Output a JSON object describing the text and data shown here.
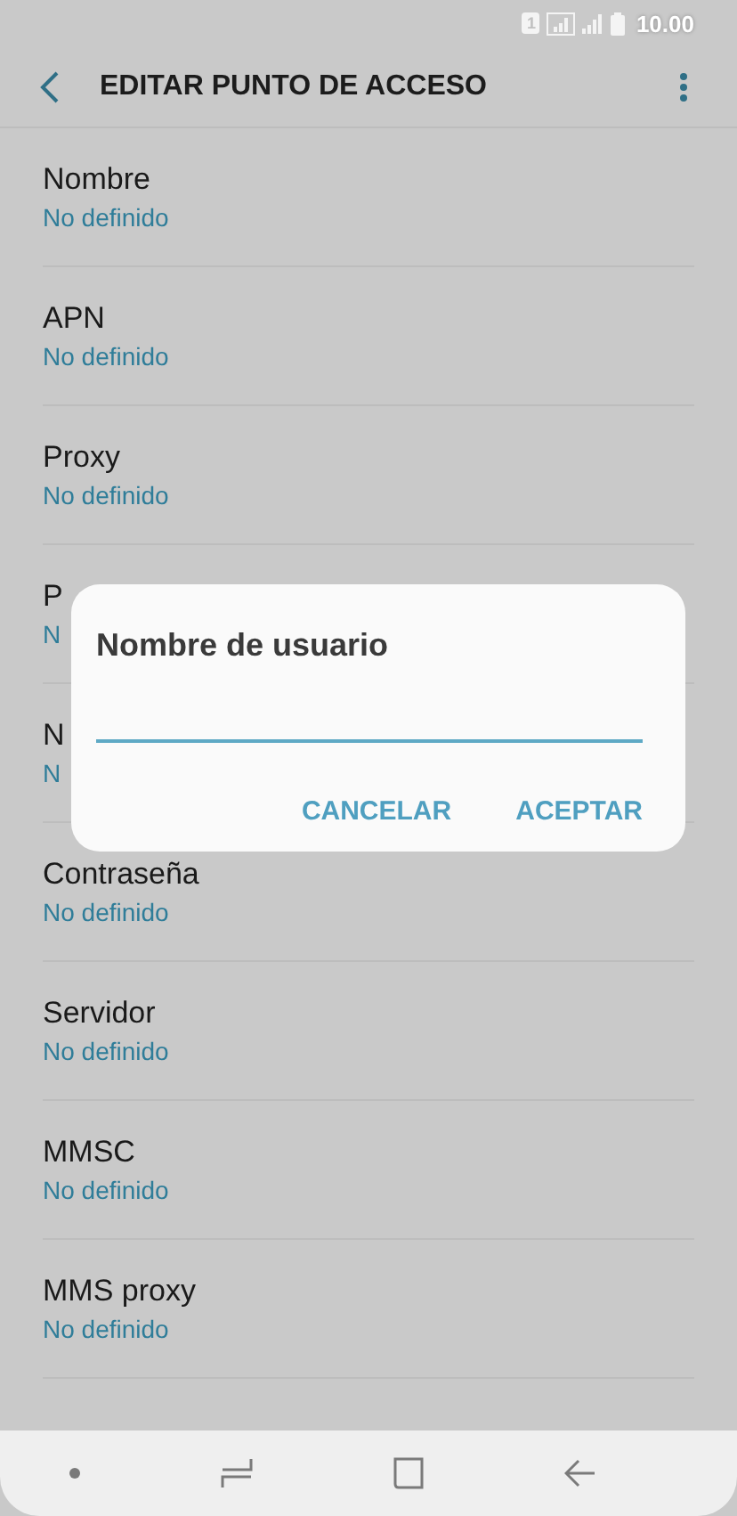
{
  "status_bar": {
    "sim": "1",
    "time": "10.00"
  },
  "app_bar": {
    "title": "EDITAR PUNTO DE ACCESO"
  },
  "settings": [
    {
      "title": "Nombre",
      "value": "No definido"
    },
    {
      "title": "APN",
      "value": "No definido"
    },
    {
      "title": "Proxy",
      "value": "No definido"
    },
    {
      "title": "P",
      "value": "N"
    },
    {
      "title": "N",
      "value": "N"
    },
    {
      "title": "Contraseña",
      "value": "No definido"
    },
    {
      "title": "Servidor",
      "value": "No definido"
    },
    {
      "title": "MMSC",
      "value": "No definido"
    },
    {
      "title": "MMS proxy",
      "value": "No definido"
    }
  ],
  "dialog": {
    "title": "Nombre de usuario",
    "buttons": [
      "CANCELAR",
      "ACEPTAR"
    ]
  }
}
